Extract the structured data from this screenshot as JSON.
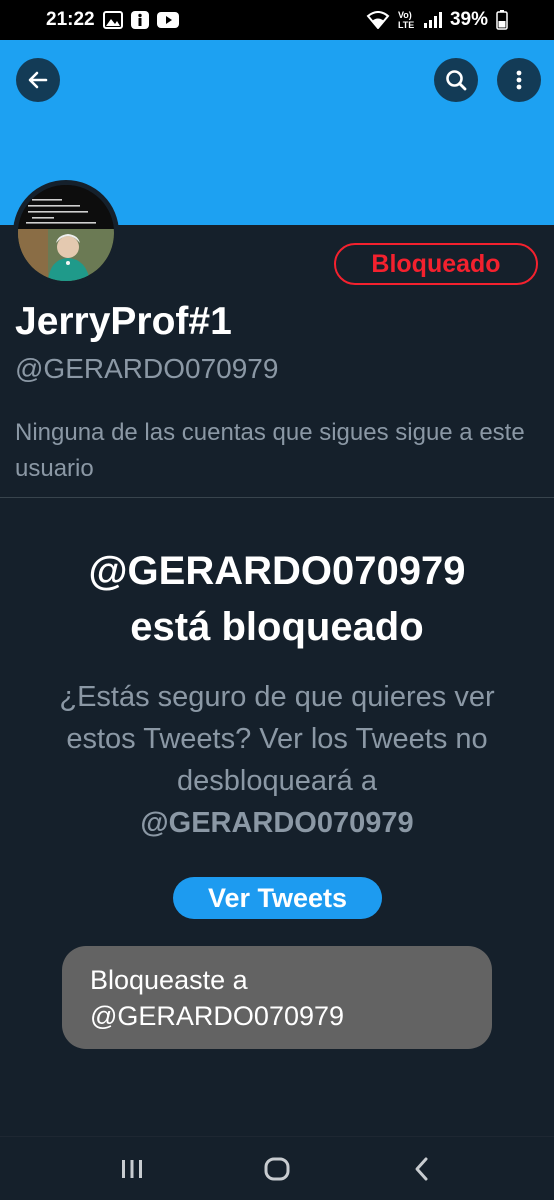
{
  "status_bar": {
    "time": "21:22",
    "battery": "39%",
    "network_label": "Vo) LTE",
    "icons": [
      "gallery-icon",
      "info-icon",
      "youtube-icon",
      "wifi-icon",
      "signal-icon",
      "battery-icon"
    ]
  },
  "header": {
    "back_icon": "arrow-left-icon",
    "search_icon": "search-icon",
    "more_icon": "more-vertical-icon",
    "banner_color": "#1da1f2"
  },
  "profile": {
    "display_name": "JerryProf#1",
    "handle": "@GERARDO070979",
    "blocked_badge": "Bloqueado",
    "followers_note": "Ninguna de las cuentas que sigues sigue a este usuario",
    "avatar_caption_lines": [
      "...a 6 Papas.",
      "...inicio y final de los Beatles",
      "...el levantamiento y caída del muro",
      "...de Berlín.",
      "No vio la Refinería de Cadereyta."
    ]
  },
  "blocked_panel": {
    "title_handle": "@GERARDO070979",
    "title_suffix": "está bloqueado",
    "description_prefix": "¿Estás seguro de que quieres ver estos Tweets? Ver los Tweets no desbloqueará a",
    "description_handle": "@GERARDO070979",
    "view_button": "Ver Tweets"
  },
  "toast": {
    "line1": "Bloqueaste a",
    "line2": "@GERARDO070979"
  },
  "nav_bar": {
    "icons": [
      "recent-apps-icon",
      "home-icon",
      "back-icon"
    ]
  },
  "colors": {
    "background": "#15202b",
    "accent": "#1d9bf0",
    "blocked_red": "#f4212e",
    "secondary_text": "#8b98a5",
    "toast_bg": "#636363"
  }
}
